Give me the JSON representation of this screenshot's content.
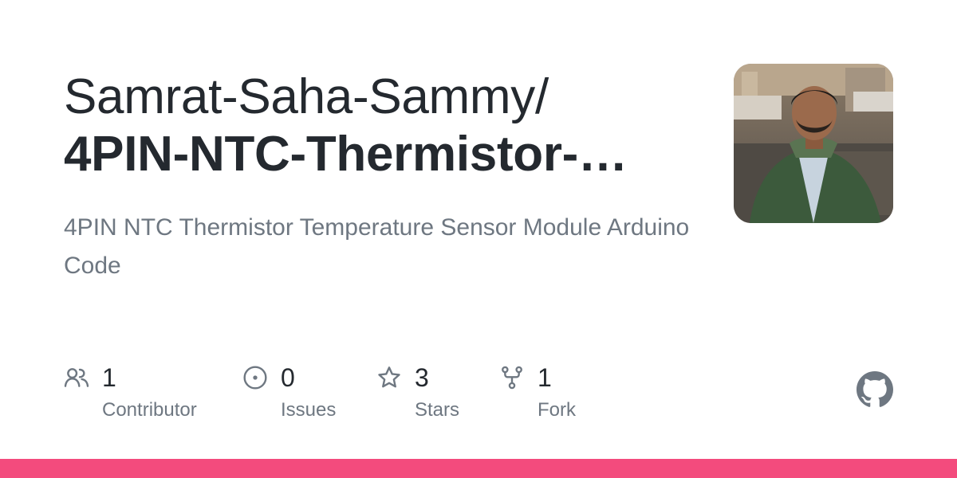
{
  "repo": {
    "owner": "Samrat-Saha-Sammy/",
    "name": "4PIN-NTC-Thermistor-…",
    "description": "4PIN NTC Thermistor Temperature Sensor Module Arduino Code"
  },
  "avatar": {
    "icon": "user-avatar-photo"
  },
  "stats": [
    {
      "icon": "people-icon",
      "count": "1",
      "label": "Contributor"
    },
    {
      "icon": "issue-opened-icon",
      "count": "0",
      "label": "Issues"
    },
    {
      "icon": "star-icon",
      "count": "3",
      "label": "Stars"
    },
    {
      "icon": "repo-forked-icon",
      "count": "1",
      "label": "Fork"
    }
  ],
  "brand": {
    "logo": "github-mark-icon",
    "language_color": "#f34b7d"
  }
}
